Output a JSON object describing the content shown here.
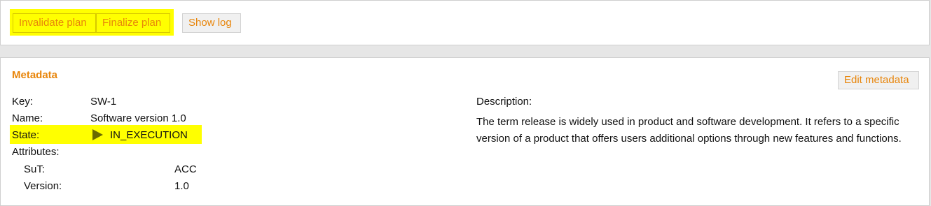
{
  "toolbar": {
    "invalidate_label": "Invalidate plan",
    "finalize_label": "Finalize plan",
    "show_log_label": "Show log"
  },
  "metadata": {
    "title": "Metadata",
    "edit_label": "Edit metadata",
    "fields": {
      "key_label": "Key:",
      "key_value": "SW-1",
      "name_label": "Name:",
      "name_value": "Software version 1.0",
      "state_label": "State:",
      "state_value": "IN_EXECUTION",
      "attributes_label": "Attributes:"
    },
    "attributes": [
      {
        "label": "SuT:",
        "value": "ACC"
      },
      {
        "label": "Version:",
        "value": "1.0"
      }
    ],
    "description_label": "Description:",
    "description_text": "The term release is widely used in product and software development. It refers to a specific version of a product that offers users additional options through new features and functions."
  },
  "colors": {
    "accent": "#e8850a",
    "highlight": "#ffff00",
    "state_icon": "#6b6b00"
  },
  "icons": {
    "state_icon": "play-icon"
  }
}
